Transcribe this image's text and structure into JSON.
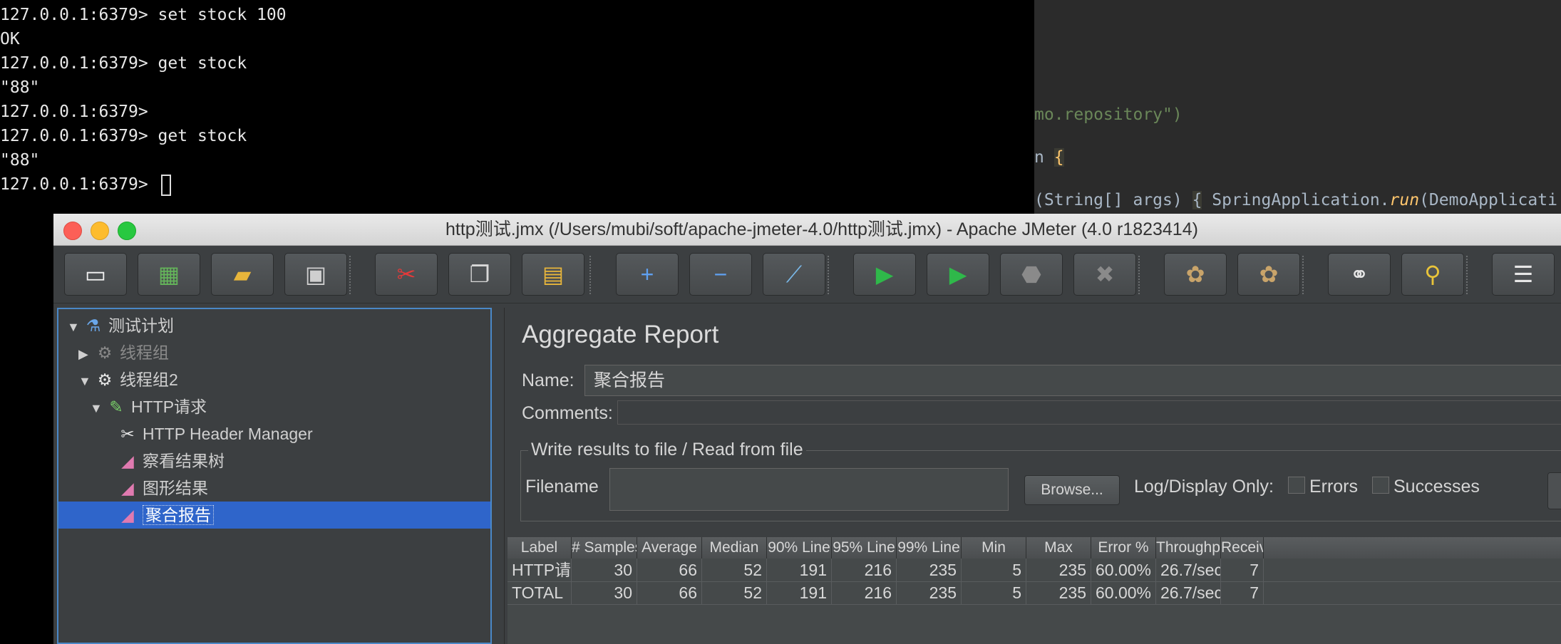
{
  "terminal": {
    "lines": [
      "127.0.0.1:6379> set stock 100",
      "OK",
      "127.0.0.1:6379> get stock",
      "\"88\"",
      "127.0.0.1:6379> ",
      "127.0.0.1:6379> get stock",
      "\"88\"",
      "127.0.0.1:6379> "
    ]
  },
  "ide": {
    "line1": "mo.repository\")",
    "line2_a": "n ",
    "line2_b": "{",
    "line3_a": "(String[] args) ",
    "line3_b": "{",
    "line3_c": " SpringApplication.",
    "line3_d": "run",
    "line3_e": "(DemoApplicati"
  },
  "window": {
    "title": "http测试.jmx (/Users/mubi/soft/apache-jmeter-4.0/http测试.jmx) - Apache JMeter (4.0 r1823414)"
  },
  "toolbar": {
    "buttons": [
      {
        "name": "new-icon",
        "glyph": "▭",
        "color": "#f2f2f2"
      },
      {
        "name": "templates-icon",
        "glyph": "▦",
        "color": "#64b45a"
      },
      {
        "name": "open-icon",
        "glyph": "▰",
        "color": "#e7b53b"
      },
      {
        "name": "save-icon",
        "glyph": "▣",
        "color": "#cfcfcf"
      },
      {
        "name": "cut-icon",
        "glyph": "✂",
        "color": "#e33a3a"
      },
      {
        "name": "copy-icon",
        "glyph": "❐",
        "color": "#d8d8d8"
      },
      {
        "name": "paste-icon",
        "glyph": "▤",
        "color": "#e7b53b"
      },
      {
        "name": "expand-icon",
        "glyph": "+",
        "color": "#5fa0f0"
      },
      {
        "name": "collapse-icon",
        "glyph": "−",
        "color": "#5fa0f0"
      },
      {
        "name": "toggle-icon",
        "glyph": "⟋",
        "color": "#7ab8e8"
      },
      {
        "name": "start-icon",
        "glyph": "▶",
        "color": "#2fb84a"
      },
      {
        "name": "start-no-pauses-icon",
        "glyph": "▶",
        "color": "#2fb84a"
      },
      {
        "name": "stop-icon",
        "glyph": "⬣",
        "color": "#8a8a8a"
      },
      {
        "name": "shutdown-icon",
        "glyph": "✖",
        "color": "#8a8a8a"
      },
      {
        "name": "clear-icon",
        "glyph": "✿",
        "color": "#c9a46a"
      },
      {
        "name": "clear-all-icon",
        "glyph": "✿",
        "color": "#c9a46a"
      },
      {
        "name": "search-icon",
        "glyph": "⚭",
        "color": "#e6e6e6"
      },
      {
        "name": "reset-search-icon",
        "glyph": "⚲",
        "color": "#e9c43a"
      },
      {
        "name": "function-helper-icon",
        "glyph": "☰",
        "color": "#e6e6e6"
      }
    ]
  },
  "tree": {
    "items": [
      {
        "label": "测试计划",
        "arrow": "▼",
        "icon": "⚗",
        "icon_name": "test-plan-icon",
        "icon_color": "#6aa6e8",
        "level": 0
      },
      {
        "label": "线程组",
        "arrow": "▶",
        "icon": "⚙",
        "icon_name": "thread-group-icon",
        "icon_color": "#888888",
        "level": 1,
        "disabled": true
      },
      {
        "label": "线程组2",
        "arrow": "▼",
        "icon": "⚙",
        "icon_name": "thread-group-icon",
        "icon_color": "#e8e8e8",
        "level": 1
      },
      {
        "label": "HTTP请求",
        "arrow": "▼",
        "icon": "✎",
        "icon_name": "sampler-icon",
        "icon_color": "#7ad06a",
        "level": 2
      },
      {
        "label": "HTTP Header Manager",
        "arrow": "",
        "icon": "✂",
        "icon_name": "header-manager-icon",
        "icon_color": "#e8e8e8",
        "level": 3
      },
      {
        "label": "察看结果树",
        "arrow": "",
        "icon": "◢",
        "icon_name": "listener-icon",
        "icon_color": "#e07ab0",
        "level": 2
      },
      {
        "label": "图形结果",
        "arrow": "",
        "icon": "◢",
        "icon_name": "listener-icon",
        "icon_color": "#e07ab0",
        "level": 2
      },
      {
        "label": "聚合报告",
        "arrow": "",
        "icon": "◢",
        "icon_name": "listener-icon",
        "icon_color": "#e07ab0",
        "level": 2,
        "selected": true
      }
    ]
  },
  "panel": {
    "title": "Aggregate Report",
    "name_label": "Name:",
    "name_value": "聚合报告",
    "comments_label": "Comments:",
    "group_title": "Write results to file / Read from file",
    "filename_label": "Filename",
    "browse_label": "Browse...",
    "log_display_label": "Log/Display Only:",
    "errors_label": "Errors",
    "successes_label": "Successes"
  },
  "table": {
    "headers": [
      "Label",
      "# Samples",
      "Average",
      "Median",
      "90% Line",
      "95% Line",
      "99% Line",
      "Min",
      "Max",
      "Error %",
      "Throughp...",
      "Receive"
    ],
    "rows": [
      [
        "HTTP请求",
        "30",
        "66",
        "52",
        "191",
        "216",
        "235",
        "5",
        "235",
        "60.00%",
        "26.7/sec",
        "7"
      ],
      [
        "TOTAL",
        "30",
        "66",
        "52",
        "191",
        "216",
        "235",
        "5",
        "235",
        "60.00%",
        "26.7/sec",
        "7"
      ]
    ]
  }
}
